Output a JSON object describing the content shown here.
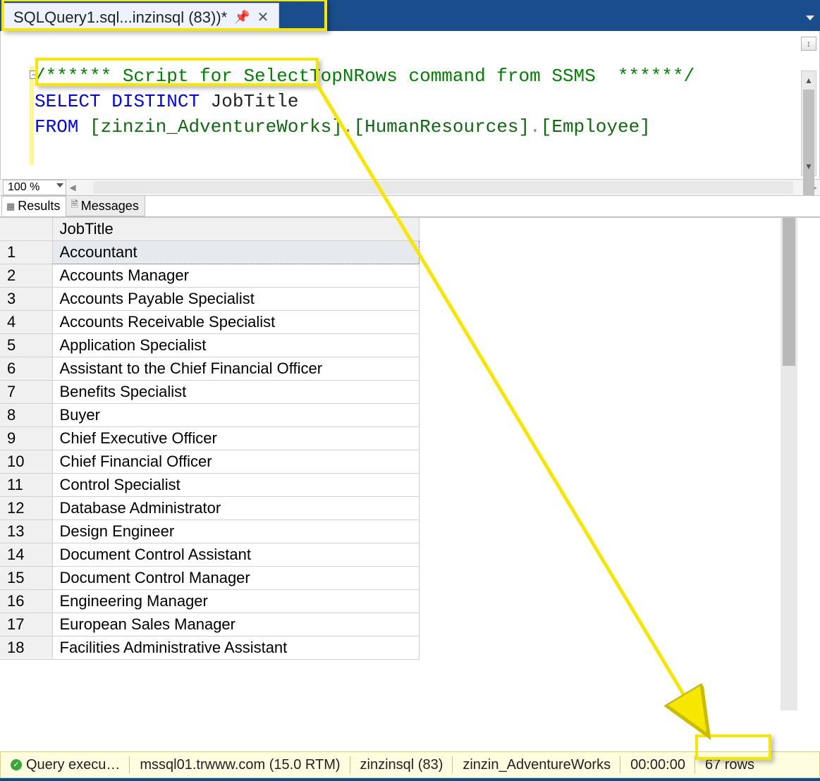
{
  "tab": {
    "title": "SQLQuery1.sql...inzinsql (83))*"
  },
  "editor": {
    "zoom": "100 %",
    "code": {
      "line1_comment": "/****** Script for SelectTopNRows command from SSMS  ******/",
      "line2_select": "SELECT",
      "line2_distinct": "DISTINCT",
      "line2_col": "JobTitle",
      "line3_from": "FROM",
      "line3_db": "[zinzin_AdventureWorks]",
      "line3_dot1": ".",
      "line3_schema": "[HumanResources]",
      "line3_dot2": ".",
      "line3_table": "[Employee]"
    }
  },
  "resultTabs": {
    "results": "Results",
    "messages": "Messages"
  },
  "grid": {
    "header": "JobTitle",
    "rows": [
      "Accountant",
      "Accounts Manager",
      "Accounts Payable Specialist",
      "Accounts Receivable Specialist",
      "Application Specialist",
      "Assistant to the Chief Financial Officer",
      "Benefits Specialist",
      "Buyer",
      "Chief Executive Officer",
      "Chief Financial Officer",
      "Control Specialist",
      "Database Administrator",
      "Design Engineer",
      "Document Control Assistant",
      "Document Control Manager",
      "Engineering Manager",
      "European Sales Manager",
      "Facilities Administrative Assistant"
    ]
  },
  "status": {
    "exec": "Query execu…",
    "server": "mssql01.trwww.com (15.0 RTM)",
    "login": "zinzinsql (83)",
    "db": "zinzin_AdventureWorks",
    "time": "00:00:00",
    "rows": "67 rows"
  }
}
